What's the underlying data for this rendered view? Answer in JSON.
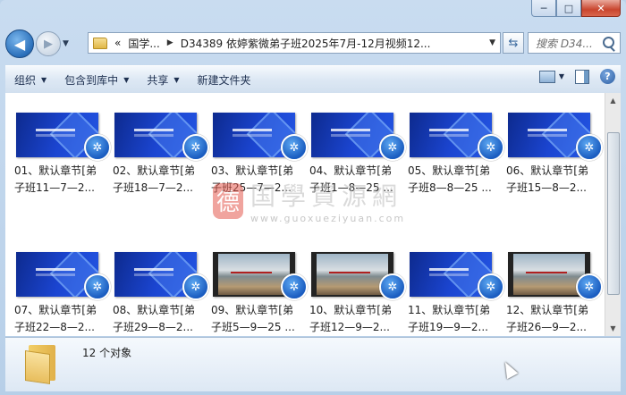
{
  "window": {
    "caption_buttons": {
      "minimize": "─",
      "maximize": "□",
      "close": "✕"
    }
  },
  "address_bar": {
    "prefix": "«",
    "crumbs": [
      "国学...",
      "D34389 依婷紫微弟子班2025年7月-12月视频12..."
    ]
  },
  "search": {
    "placeholder": "搜索 D34..."
  },
  "toolbar": {
    "items": [
      "组织",
      "包含到库中",
      "共享",
      "新建文件夹"
    ]
  },
  "files": [
    {
      "line1": "01、默认章节[弟",
      "line2": "子班11—7—2...",
      "thumb": "blue"
    },
    {
      "line1": "02、默认章节[弟",
      "line2": "子班18—7—2...",
      "thumb": "blue"
    },
    {
      "line1": "03、默认章节[弟",
      "line2": "子班25—7—2...",
      "thumb": "blue"
    },
    {
      "line1": "04、默认章节[弟",
      "line2": "子班1—8—25 ...",
      "thumb": "blue"
    },
    {
      "line1": "05、默认章节[弟",
      "line2": "子班8—8—25 ...",
      "thumb": "blue"
    },
    {
      "line1": "06、默认章节[弟",
      "line2": "子班15—8—2...",
      "thumb": "blue"
    },
    {
      "line1": "07、默认章节[弟",
      "line2": "子班22—8—2...",
      "thumb": "blue"
    },
    {
      "line1": "08、默认章节[弟",
      "line2": "子班29—8—2...",
      "thumb": "blue"
    },
    {
      "line1": "09、默认章节[弟",
      "line2": "子班5—9—25 ...",
      "thumb": "photo"
    },
    {
      "line1": "10、默认章节[弟",
      "line2": "子班12—9—2...",
      "thumb": "photo"
    },
    {
      "line1": "11、默认章节[弟",
      "line2": "子班19—9—2...",
      "thumb": "blue"
    },
    {
      "line1": "12、默认章节[弟",
      "line2": "子班26—9—2...",
      "thumb": "photo"
    }
  ],
  "watermark": {
    "seal": "德",
    "title": "国學資源網",
    "url": "www.guoxueziyuan.com"
  },
  "status": {
    "count_text": "12 个对象"
  }
}
